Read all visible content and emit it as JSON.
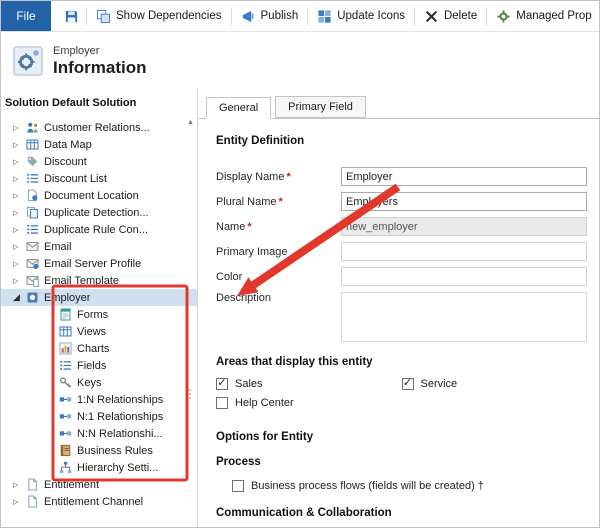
{
  "colors": {
    "file-tab": "#2263a7",
    "accent": "#3b79c3",
    "selection": "#cfe0f0",
    "annotation": "#e2382c"
  },
  "toolbar": {
    "file_label": "File",
    "items": [
      {
        "label": "Show Dependencies",
        "icon": "show-dependencies-icon"
      },
      {
        "label": "Publish",
        "icon": "publish-icon"
      },
      {
        "label": "Update Icons",
        "icon": "update-icons-icon"
      },
      {
        "label": "Delete",
        "icon": "delete-icon"
      },
      {
        "label": "Managed Prop",
        "icon": "managed-properties-icon"
      }
    ],
    "save_icon": "save-icon"
  },
  "header": {
    "subtitle": "Employer",
    "title": "Information"
  },
  "sidebar": {
    "title": "Solution Default Solution",
    "items": [
      {
        "label": "Customer Relations...",
        "icon": "customer-relationship-icon"
      },
      {
        "label": "Data Map",
        "icon": "data-map-icon"
      },
      {
        "label": "Discount",
        "icon": "discount-icon"
      },
      {
        "label": "Discount List",
        "icon": "discount-list-icon"
      },
      {
        "label": "Document Location",
        "icon": "document-location-icon"
      },
      {
        "label": "Duplicate Detection...",
        "icon": "duplicate-detection-icon"
      },
      {
        "label": "Duplicate Rule Con...",
        "icon": "duplicate-rule-icon"
      },
      {
        "label": "Email",
        "icon": "email-icon"
      },
      {
        "label": "Email Server Profile",
        "icon": "email-server-profile-icon"
      },
      {
        "label": "Email Template",
        "icon": "email-template-icon"
      },
      {
        "label": "Employer",
        "icon": "entity-icon",
        "expanded": true,
        "selected": true,
        "children": [
          {
            "label": "Forms",
            "icon": "forms-icon"
          },
          {
            "label": "Views",
            "icon": "views-icon"
          },
          {
            "label": "Charts",
            "icon": "charts-icon"
          },
          {
            "label": "Fields",
            "icon": "fields-icon"
          },
          {
            "label": "Keys",
            "icon": "keys-icon"
          },
          {
            "label": "1:N Relationships",
            "icon": "one-to-many-relationships-icon"
          },
          {
            "label": "N:1 Relationships",
            "icon": "many-to-one-relationships-icon"
          },
          {
            "label": "N:N Relationshi...",
            "icon": "many-to-many-relationships-icon"
          },
          {
            "label": "Business Rules",
            "icon": "business-rules-icon"
          },
          {
            "label": "Hierarchy Setti...",
            "icon": "hierarchy-settings-icon"
          }
        ]
      },
      {
        "label": "Entitlement",
        "icon": "entitlement-icon"
      },
      {
        "label": "Entitlement Channel",
        "icon": "entitlement-channel-icon"
      }
    ]
  },
  "tabs": [
    {
      "label": "General",
      "active": true
    },
    {
      "label": "Primary Field",
      "active": false
    }
  ],
  "form": {
    "section_entity": "Entity Definition",
    "fields": [
      {
        "label": "Display Name",
        "required": "*",
        "value": "Employer"
      },
      {
        "label": "Plural Name",
        "required": "*",
        "value": "Employers"
      },
      {
        "label": "Name",
        "required": "*",
        "value": "new_employer",
        "disabled": true
      },
      {
        "label": "Primary Image",
        "value": ""
      },
      {
        "label": "Color",
        "value": ""
      },
      {
        "label": "Description",
        "value": ""
      }
    ],
    "section_areas": "Areas that display this entity",
    "areas": [
      {
        "label": "Sales",
        "checked": true
      },
      {
        "label": "Service",
        "checked": true
      },
      {
        "label": "Help Center",
        "checked": false
      }
    ],
    "section_options": "Options for Entity",
    "process_heading": "Process",
    "process_checkbox": {
      "label": "Business process flows (fields will be created) †",
      "checked": false
    },
    "section_communication": "Communication & Collaboration"
  }
}
